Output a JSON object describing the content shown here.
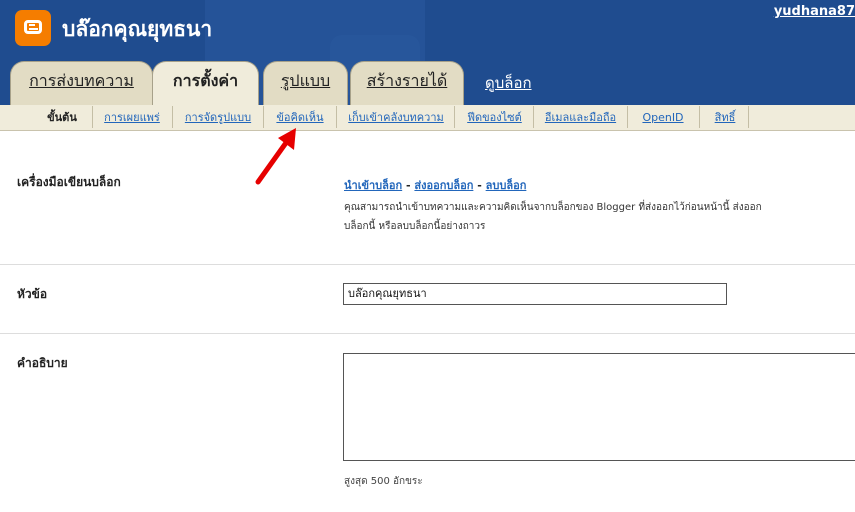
{
  "header": {
    "blog_title": "บล๊อกคุณยุทธนา",
    "username": "yudhana87",
    "view_blog": "ดูบล็อก",
    "colors": {
      "header_bg": "#1f4c8f",
      "logo": "#f57d00",
      "tab": "#e2dcc4",
      "tab_active": "#f0ecdb",
      "link": "#2266bb",
      "arrow": "#e60000"
    }
  },
  "tabs": [
    {
      "label": "การส่งบทความ",
      "active": false
    },
    {
      "label": "การตั้งค่า",
      "active": true
    },
    {
      "label": "รูปแบบ",
      "active": false
    },
    {
      "label": "สร้างรายได้",
      "active": false
    }
  ],
  "subnav": [
    {
      "label": "ขั้นต้น",
      "active": true
    },
    {
      "label": "การเผยแพร่",
      "active": false
    },
    {
      "label": "การจัดรูปแบบ",
      "active": false
    },
    {
      "label": "ข้อคิดเห็น",
      "active": false
    },
    {
      "label": "เก็บเข้าคลังบทความ",
      "active": false
    },
    {
      "label": "ฟีดของไซต์",
      "active": false
    },
    {
      "label": "อีเมลและมือถือ",
      "active": false
    },
    {
      "label": "OpenID",
      "active": false
    },
    {
      "label": "สิทธิ์",
      "active": false
    }
  ],
  "blog_tools": {
    "label": "เครื่องมือเขียนบล็อก",
    "import": "นำเข้าบล็อก",
    "export": "ส่งออกบล็อก",
    "delete": "ลบบล็อก",
    "separator": "-",
    "description": "คุณสามารถนำเข้าบทความและความคิดเห็นจากบล็อกของ Blogger ที่ส่งออกไว้ก่อนหน้านี้ ส่งออกบล็อกนี้ หรือลบบล็อกนี้อย่างถาวร"
  },
  "title_field": {
    "label": "หัวข้อ",
    "value": "บล๊อกคุณยุทธนา"
  },
  "description_field": {
    "label": "คำอธิบาย",
    "value": "",
    "max_length_note": "สูงสุด 500 อักขระ"
  }
}
